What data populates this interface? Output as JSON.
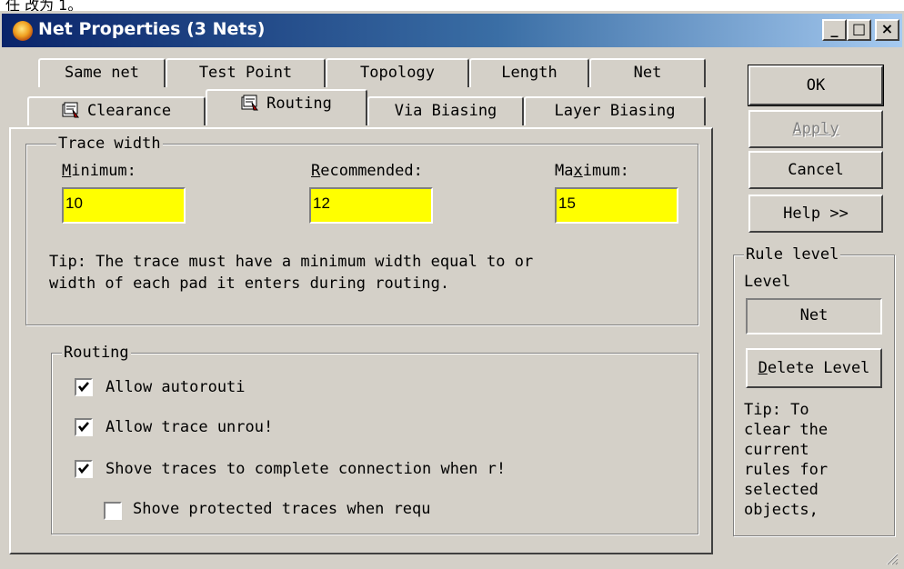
{
  "top_strip": {
    "text": "任 改为 1。"
  },
  "window": {
    "title": "Net Properties (3 Nets)",
    "caption_buttons": {
      "minimize": "_",
      "maximize": "□",
      "close": "×"
    }
  },
  "tabs": {
    "row1": [
      "Same net",
      "Test Point",
      "Topology",
      "Length",
      "Net"
    ],
    "row2": [
      "Clearance",
      "Routing",
      "Via Biasing",
      "Layer Biasing"
    ],
    "active": "Routing"
  },
  "trace_width": {
    "group_label": "Trace width",
    "minimum": {
      "label_u": "M",
      "label_rest": "inimum:",
      "value": "10"
    },
    "recommended": {
      "label_u": "R",
      "label_rest": "ecommended:",
      "value": "12"
    },
    "maximum": {
      "label_pre": "Ma",
      "label_u": "x",
      "label_rest": "imum:",
      "value": "15"
    },
    "tip_line1": "Tip: The trace must have a minimum width equal to or",
    "tip_line2": "width of each pad it enters during routing."
  },
  "routing": {
    "group_label": "Routing",
    "options": [
      {
        "label": "Allow autorouti",
        "checked": true
      },
      {
        "label": "Allow trace unrou!",
        "checked": true
      },
      {
        "label": "Shove traces to complete connection when r!",
        "checked": true
      },
      {
        "label": "Shove protected traces when requ",
        "checked": false
      }
    ]
  },
  "buttons": {
    "ok": "OK",
    "apply": "Apply",
    "cancel": "Cancel",
    "help": "Help >>"
  },
  "rule_level": {
    "group_label": "Rule level",
    "level_label": "Level",
    "level_value": "Net",
    "delete_u": "D",
    "delete_rest": "elete Level",
    "tip": "Tip: To\nclear the\ncurrent\nrules for\nselected\nobjects,"
  },
  "colors": {
    "field_bg": "#ffff00",
    "face": "#d4d0c8",
    "title_start": "#0a246a",
    "title_end": "#a6caf0"
  }
}
